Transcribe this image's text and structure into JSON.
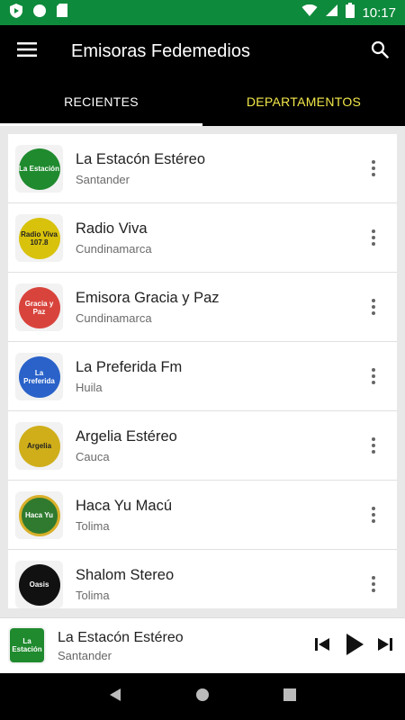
{
  "status": {
    "time": "10:17"
  },
  "app": {
    "title": "Emisoras Fedemedios"
  },
  "tabs": [
    {
      "label": "RECIENTES"
    },
    {
      "label": "DEPARTAMENTOS"
    }
  ],
  "stations": [
    {
      "name": "La Estacón Estéreo",
      "region": "Santander",
      "logo_text": "La Estación",
      "logo_color": "#1f8a2e"
    },
    {
      "name": "Radio Viva",
      "region": "Cundinamarca",
      "logo_text": "Radio Viva 107.8",
      "logo_color": "#d8c20c"
    },
    {
      "name": "Emisora Gracia y Paz",
      "region": "Cundinamarca",
      "logo_text": "Gracia y Paz",
      "logo_color": "#d8443c"
    },
    {
      "name": "La Preferida Fm",
      "region": "Huila",
      "logo_text": "La Preferida",
      "logo_color": "#2a62c9"
    },
    {
      "name": "Argelia Estéreo",
      "region": "Cauca",
      "logo_text": "Argelia",
      "logo_color": "#cfae1a"
    },
    {
      "name": "Haca Yu Macú",
      "region": "Tolima",
      "logo_text": "Haca Yu",
      "logo_color": "#2f7a2f"
    },
    {
      "name": "Shalom Stereo",
      "region": "Tolima",
      "logo_text": "Oasis",
      "logo_color": "#111111"
    }
  ],
  "player": {
    "title": "La Estacón Estéreo",
    "subtitle": "Santander",
    "logo_text": "La Estación",
    "logo_color": "#1f8a2e"
  },
  "colors": {
    "status_bar": "#0e8a3c",
    "app_bar": "#000000",
    "inactive_tab": "#f3e84a"
  }
}
